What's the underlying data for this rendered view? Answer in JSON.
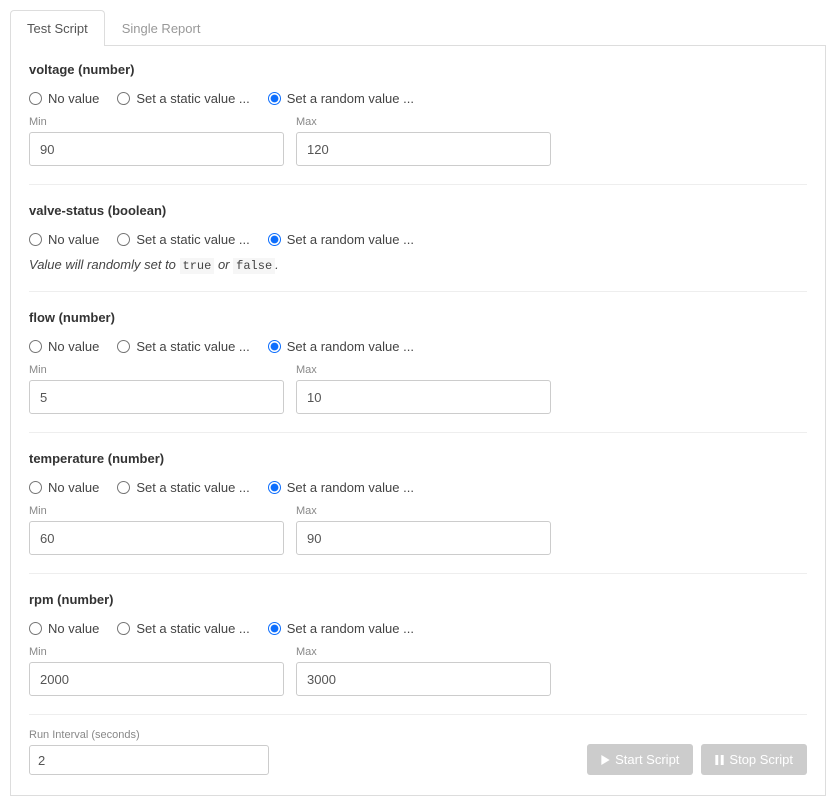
{
  "tabs": [
    {
      "label": "Test Script",
      "active": true
    },
    {
      "label": "Single Report",
      "active": false
    }
  ],
  "radioLabels": {
    "noValue": "No value",
    "static": "Set a static value ...",
    "random": "Set a random value ..."
  },
  "fieldLabels": {
    "min": "Min",
    "max": "Max"
  },
  "sections": [
    {
      "key": "voltage",
      "title": "voltage (number)",
      "type": "number",
      "selected": "random",
      "min": "90",
      "max": "120"
    },
    {
      "key": "valve-status",
      "title": "valve-status (boolean)",
      "type": "boolean",
      "selected": "random",
      "note_prefix": "Value will randomly set to ",
      "note_code1": "true",
      "note_mid": " or ",
      "note_code2": "false",
      "note_suffix": "."
    },
    {
      "key": "flow",
      "title": "flow (number)",
      "type": "number",
      "selected": "random",
      "min": "5",
      "max": "10"
    },
    {
      "key": "temperature",
      "title": "temperature (number)",
      "type": "number",
      "selected": "random",
      "min": "60",
      "max": "90"
    },
    {
      "key": "rpm",
      "title": "rpm (number)",
      "type": "number",
      "selected": "random",
      "min": "2000",
      "max": "3000"
    }
  ],
  "runInterval": {
    "label": "Run Interval (seconds)",
    "value": "2"
  },
  "buttons": {
    "start": "Start Script",
    "stop": "Stop Script"
  }
}
